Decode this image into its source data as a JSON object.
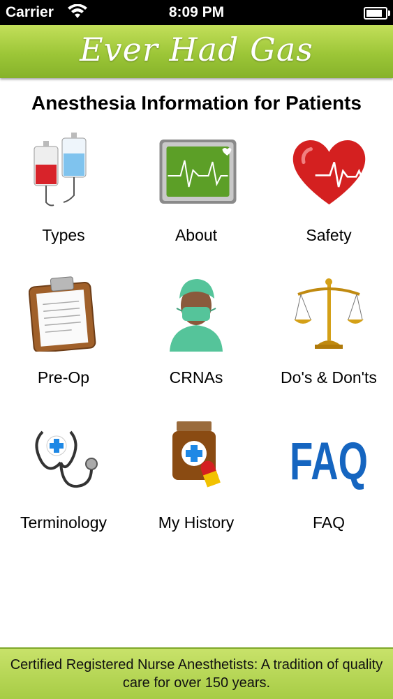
{
  "status_bar": {
    "carrier": "Carrier",
    "time": "8:09 PM"
  },
  "header": {
    "logo": "Ever Had Gas"
  },
  "page_title": "Anesthesia Information for Patients",
  "menu": [
    {
      "label": "Types",
      "icon": "iv-bags-icon"
    },
    {
      "label": "About",
      "icon": "heart-monitor-icon"
    },
    {
      "label": "Safety",
      "icon": "heart-pulse-icon"
    },
    {
      "label": "Pre-Op",
      "icon": "clipboard-icon"
    },
    {
      "label": "CRNAs",
      "icon": "nurse-anesthetist-icon"
    },
    {
      "label": "Do's & Don'ts",
      "icon": "scales-icon"
    },
    {
      "label": "Terminology",
      "icon": "stethoscope-icon"
    },
    {
      "label": "My History",
      "icon": "medicine-bottle-icon"
    },
    {
      "label": "FAQ",
      "icon": "faq-icon"
    }
  ],
  "faq_icon_text": "FAQ",
  "footer": {
    "text": "Certified Registered Nurse Anesthetists: A tradition of quality care for over 150 years."
  },
  "colors": {
    "brand_green": "#9cc637",
    "faq_blue": "#1565c0",
    "heart_red": "#d42020"
  }
}
